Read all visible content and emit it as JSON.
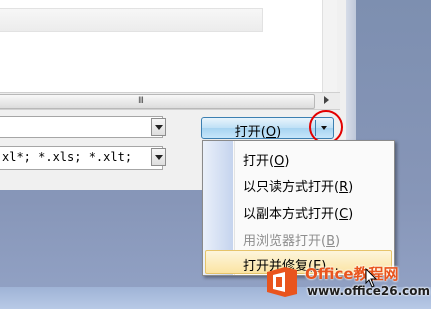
{
  "file_dialog": {
    "filename_value": "",
    "filetype_value": "xl*; *.xls; *.xlt;",
    "scroll_grip": "III"
  },
  "open_button": {
    "label": "打开(O)"
  },
  "open_menu": {
    "items": [
      {
        "label": "打开(O)",
        "enabled": true
      },
      {
        "label": "以只读方式打开(R)",
        "enabled": true
      },
      {
        "label": "以副本方式打开(C)",
        "enabled": true
      },
      {
        "label": "用浏览器打开(B)",
        "enabled": false
      },
      {
        "label": "打开并修复(E)...",
        "enabled": true,
        "highlighted": true
      }
    ]
  },
  "watermark": {
    "title": "Office教程网",
    "url": "www.office26.com",
    "brand_color": "#e9541d"
  },
  "colors": {
    "highlight_circle": "#e30000",
    "button_border": "#3c7fb1"
  }
}
